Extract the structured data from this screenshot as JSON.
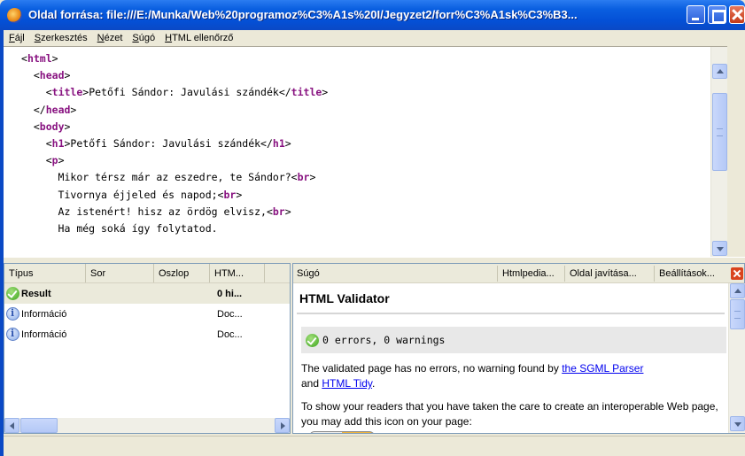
{
  "window": {
    "title": "Oldal forrása: file:///E:/Munka/Web%20programoz%C3%A1s%20I/Jegyzet2/forr%C3%A1sk%C3%B3..."
  },
  "menu": [
    "Fájl",
    "Szerkesztés",
    "Nézet",
    "Súgó",
    "HTML ellenőrző"
  ],
  "source_lines": [
    {
      "indent": "",
      "parts": [
        {
          "t": "<",
          "k": "p"
        },
        {
          "t": "html",
          "k": "tag"
        },
        {
          "t": ">",
          "k": "p"
        }
      ]
    },
    {
      "indent": "  ",
      "parts": [
        {
          "t": "<",
          "k": "p"
        },
        {
          "t": "head",
          "k": "tag"
        },
        {
          "t": ">",
          "k": "p"
        }
      ]
    },
    {
      "indent": "    ",
      "parts": [
        {
          "t": "<",
          "k": "p"
        },
        {
          "t": "title",
          "k": "tag"
        },
        {
          "t": ">Petőfi Sándor: Javulási szándék</",
          "k": "p"
        },
        {
          "t": "title",
          "k": "tag"
        },
        {
          "t": ">",
          "k": "p"
        }
      ]
    },
    {
      "indent": "  ",
      "parts": [
        {
          "t": "</",
          "k": "p"
        },
        {
          "t": "head",
          "k": "tag"
        },
        {
          "t": ">",
          "k": "p"
        }
      ]
    },
    {
      "indent": "  ",
      "parts": [
        {
          "t": "<",
          "k": "p"
        },
        {
          "t": "body",
          "k": "tag"
        },
        {
          "t": ">",
          "k": "p"
        }
      ]
    },
    {
      "indent": "    ",
      "parts": [
        {
          "t": "<",
          "k": "p"
        },
        {
          "t": "h1",
          "k": "tag"
        },
        {
          "t": ">Petőfi Sándor: Javulási szándék</",
          "k": "p"
        },
        {
          "t": "h1",
          "k": "tag"
        },
        {
          "t": ">",
          "k": "p"
        }
      ]
    },
    {
      "indent": "    ",
      "parts": [
        {
          "t": "<",
          "k": "p"
        },
        {
          "t": "p",
          "k": "tag"
        },
        {
          "t": ">",
          "k": "p"
        }
      ]
    },
    {
      "indent": "      ",
      "parts": [
        {
          "t": "Mikor térsz már az eszedre, te Sándor?<",
          "k": "p"
        },
        {
          "t": "br",
          "k": "tag"
        },
        {
          "t": ">",
          "k": "p"
        }
      ]
    },
    {
      "indent": "      ",
      "parts": [
        {
          "t": "Tivornya éjjeled és napod;<",
          "k": "p"
        },
        {
          "t": "br",
          "k": "tag"
        },
        {
          "t": ">",
          "k": "p"
        }
      ]
    },
    {
      "indent": "      ",
      "parts": [
        {
          "t": "Az istenért! hisz az ördög elvisz,<",
          "k": "p"
        },
        {
          "t": "br",
          "k": "tag"
        },
        {
          "t": ">",
          "k": "p"
        }
      ]
    },
    {
      "indent": "      ",
      "parts": [
        {
          "t": "Ha még soká így folytatod.",
          "k": "p"
        }
      ]
    }
  ],
  "results": {
    "columns": [
      "Típus",
      "Sor",
      "Oszlop",
      "HTM..."
    ],
    "rows": [
      {
        "type": "Result",
        "icon": "check-icon",
        "sor": "",
        "oszlop": "",
        "htm": "0 hi...",
        "bold": true
      },
      {
        "type": "Információ",
        "icon": "info-icon",
        "sor": "",
        "oszlop": "",
        "htm": "Doc...",
        "bold": false
      },
      {
        "type": "Információ",
        "icon": "info-icon",
        "sor": "",
        "oszlop": "",
        "htm": "Doc...",
        "bold": false
      }
    ]
  },
  "help": {
    "tab_label": "Súgó",
    "buttons": [
      "Htmlpedia...",
      "Oldal javítása...",
      "Beállítások..."
    ],
    "heading": "HTML Validator",
    "status": "0 errors, 0 warnings",
    "p1_before": "The validated page has no errors, no warning found by ",
    "p1_link1": "the SGML Parser",
    "p1_mid": "and ",
    "p1_link2": "HTML Tidy",
    "p1_after": ".",
    "p2": "To show your readers that you have taken the care to create an interoperable Web page, you may add this icon on your page:"
  },
  "colors": {
    "tag": "#881280",
    "titlebar": "#0a5fe0",
    "link": "#0000ee"
  }
}
